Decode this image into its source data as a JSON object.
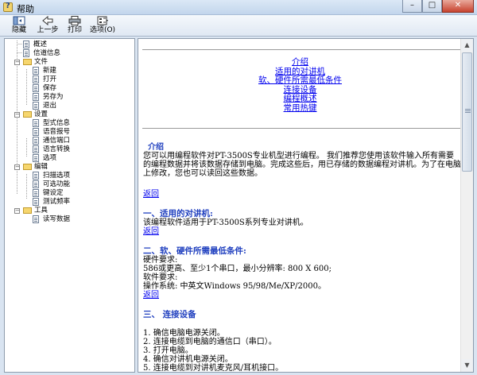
{
  "window": {
    "title": "帮助"
  },
  "toolbar": {
    "buttons": [
      {
        "label": "隐藏",
        "icon": "hide-icon"
      },
      {
        "label": "上一步",
        "icon": "back-arrow-icon"
      },
      {
        "label": "打印",
        "icon": "printer-icon"
      },
      {
        "label": "选项(O)",
        "icon": "options-icon"
      }
    ]
  },
  "tree": {
    "items": [
      {
        "label": "概述",
        "type": "page",
        "level": 1
      },
      {
        "label": "信道信息",
        "type": "page",
        "level": 1
      },
      {
        "label": "文件",
        "type": "folder",
        "level": 0
      },
      {
        "label": "新建",
        "type": "page",
        "level": 2
      },
      {
        "label": "打开",
        "type": "page",
        "level": 2
      },
      {
        "label": "保存",
        "type": "page",
        "level": 2
      },
      {
        "label": "另存为",
        "type": "page",
        "level": 2
      },
      {
        "label": "退出",
        "type": "page",
        "level": 2
      },
      {
        "label": "设置",
        "type": "folder",
        "level": 0
      },
      {
        "label": "型式信息",
        "type": "page",
        "level": 2
      },
      {
        "label": "语音报号",
        "type": "page",
        "level": 2
      },
      {
        "label": "通信端口",
        "type": "page",
        "level": 2
      },
      {
        "label": "语言转换",
        "type": "page",
        "level": 2
      },
      {
        "label": "选项",
        "type": "page",
        "level": 2
      },
      {
        "label": "编辑",
        "type": "folder",
        "level": 0
      },
      {
        "label": "扫描选项",
        "type": "page",
        "level": 2
      },
      {
        "label": "可选功能",
        "type": "page",
        "level": 2
      },
      {
        "label": "键设定",
        "type": "page",
        "level": 2
      },
      {
        "label": "测试频率",
        "type": "page",
        "level": 2
      },
      {
        "label": "工具",
        "type": "folder",
        "level": 0
      },
      {
        "label": "读写数据",
        "type": "page",
        "level": 2
      }
    ]
  },
  "content": {
    "toc": [
      "介绍",
      "适用的对讲机",
      "软、硬件所需最低条件",
      "连接设备",
      "编程概述",
      "常用热键"
    ],
    "intro": {
      "title": "介绍",
      "text": "您可以用编程软件对PT-3500S专业机型进行编程。 我们推荐您使用该软件输入所有需要的编程数据并将该数据存储到电脑。完成这些后，用已存储的数据编程对讲机。为了在电脑上修改，您也可以读回这些数据。"
    },
    "back_label": "返回",
    "section1": {
      "title": "一、适用的对讲机:",
      "text": "该编程软件适用于PT-3500S系列专业对讲机。"
    },
    "section2": {
      "title": "二、软、硬件所需最低条件:",
      "lines": [
        "硬件要求:",
        "586或更高、至少1个串口，最小分辨率: 800 X 600;",
        "软件要求:",
        "操作系统: 中英文Windows 95/98/Me/XP/2000。"
      ]
    },
    "section3": {
      "title": "三、 连接设备",
      "lines": [
        "1. 确信电脑电源关闭。",
        "2. 连接电缆到电脑的通信口（串口）。",
        "3. 打开电脑。",
        "4. 确信对讲机电源关闭。",
        "5. 连接电缆到对讲机麦克风/耳机接口。"
      ]
    }
  }
}
